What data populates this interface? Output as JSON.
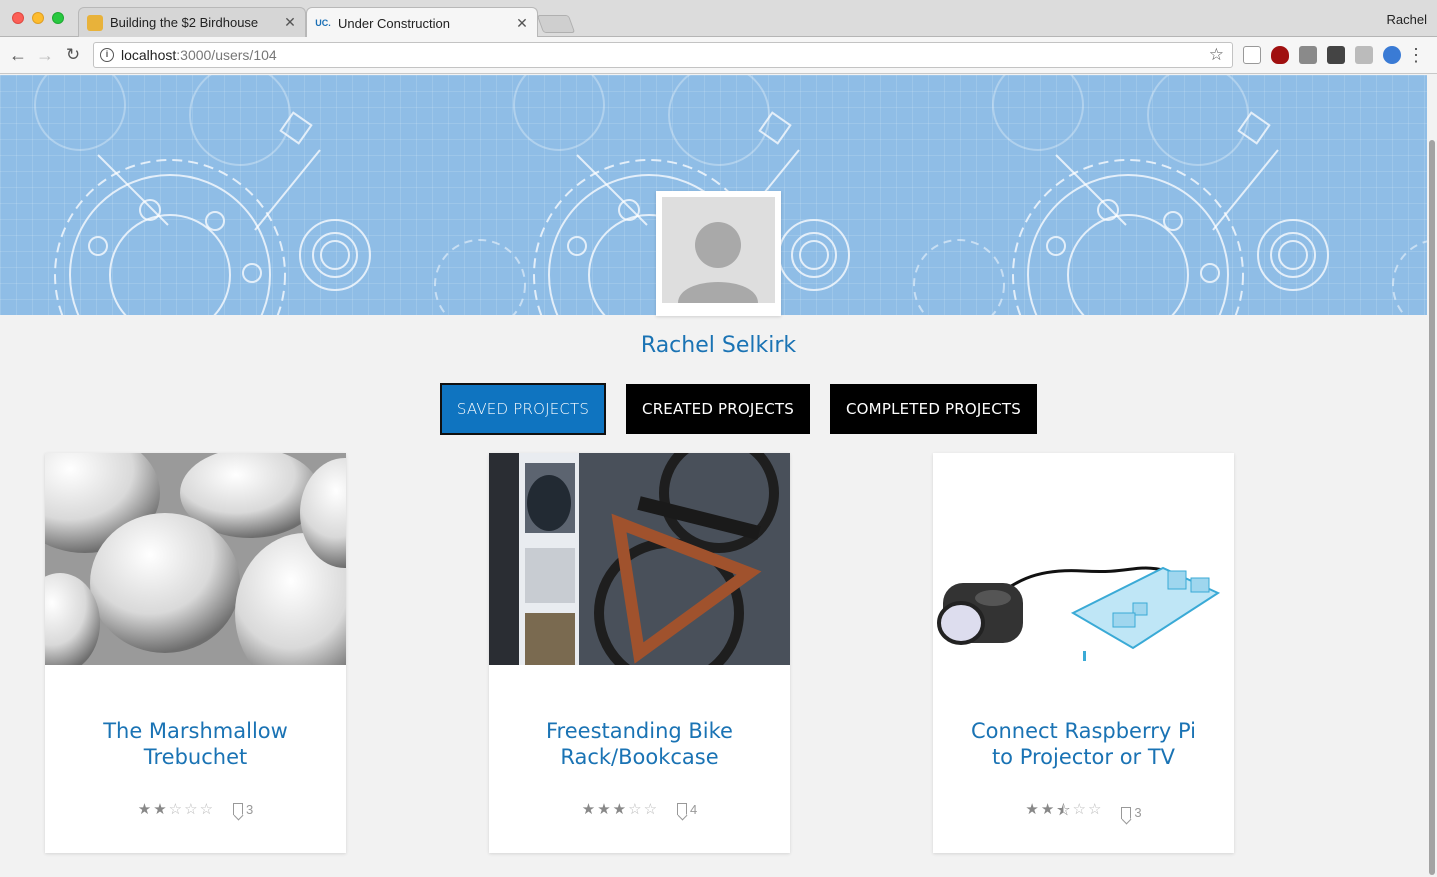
{
  "browser": {
    "tabs": [
      {
        "title": "Building the $2 Birdhouse",
        "favicon": "birdhouse-icon",
        "active": false
      },
      {
        "title": "Under Construction",
        "favicon": "uc-logo-icon",
        "favicon_text": "UC.",
        "active": true
      }
    ],
    "profile_name": "Rachel",
    "url_host": "localhost",
    "url_path": ":3000/users/104"
  },
  "profile": {
    "name": "Rachel Selkirk"
  },
  "project_tabs": {
    "saved": "SAVED PROJECTS",
    "created": "CREATED PROJECTS",
    "completed": "COMPLETED PROJECTS"
  },
  "projects": [
    {
      "title": "The Marshmallow Trebuchet",
      "rating": 2,
      "saves": "3",
      "image": "marshmallows"
    },
    {
      "title": "Freestanding Bike Rack/Bookcase",
      "rating": 3,
      "saves": "4",
      "image": "bike-rack"
    },
    {
      "title": "Connect Raspberry Pi to Projector or TV",
      "rating": 2.5,
      "saves": "3",
      "image": "raspberry-pi-projector"
    }
  ],
  "colors": {
    "accent": "#0f74c0",
    "link": "#1a73b4",
    "banner": "#8fbde6"
  }
}
